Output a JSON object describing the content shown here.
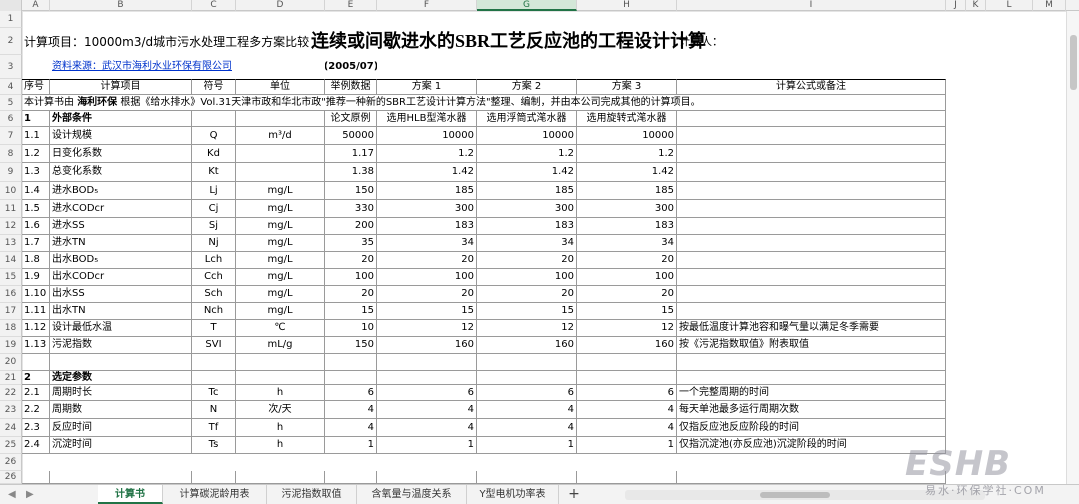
{
  "columns": [
    "A",
    "B",
    "C",
    "D",
    "E",
    "F",
    "G",
    "H",
    "I",
    "J",
    "K",
    "L",
    "M"
  ],
  "selected_column": "G",
  "title": "连续或间歇进水的SBR工艺反应池的工程设计计算",
  "project_label": "计算项目：",
  "project_name": "10000m3/d城市污水处理工程多方案比较",
  "calculator_label": "计算人：",
  "source_text": "资料来源：武汉市海利水业环保有限公司",
  "source_year": "(2005/07)",
  "headers": {
    "seq": "序号",
    "item": "计算项目",
    "symbol": "符号",
    "unit": "单位",
    "example": "举例数据",
    "plan1": "方案 1",
    "plan2": "方案 2",
    "plan3": "方案 3",
    "formula": "计算公式或备注"
  },
  "note_row": {
    "prefix": "本计算书由 ",
    "company": "海利环保",
    "suffix": " 根据《给水排水》Vol.31天津市政和华北市政\"推荐一种新的SBR工艺设计计算方法\"整理、编制，并由本公司完成其他的计算项目。"
  },
  "section1": {
    "num": "1",
    "name": "外部条件",
    "sub_example": "论文原例",
    "sub_plan1": "选用HLB型滗水器",
    "sub_plan2": "选用浮筒式滗水器",
    "sub_plan3": "选用旋转式滗水器"
  },
  "rows": [
    {
      "row": "7",
      "seq": "1.1",
      "item": "设计规模",
      "symbol": "Q",
      "unit": "m³/d",
      "ex": "50000",
      "p1": "10000",
      "p2": "10000",
      "p3": "10000",
      "note": ""
    },
    {
      "row": "8",
      "seq": "1.2",
      "item": "日变化系数",
      "symbol": "Kd",
      "unit": "",
      "ex": "1.17",
      "p1": "1.2",
      "p2": "1.2",
      "p3": "1.2",
      "note": ""
    },
    {
      "row": "9",
      "seq": "1.3",
      "item": "总变化系数",
      "symbol": "Kt",
      "unit": "",
      "ex": "1.38",
      "p1": "1.42",
      "p2": "1.42",
      "p3": "1.42",
      "note": ""
    },
    {
      "row": "10",
      "seq": "1.4",
      "item": "进水BOD₅",
      "symbol": "Lj",
      "unit": "mg/L",
      "ex": "150",
      "p1": "185",
      "p2": "185",
      "p3": "185",
      "note": ""
    },
    {
      "row": "11",
      "seq": "1.5",
      "item": "进水CODcr",
      "symbol": "Cj",
      "unit": "mg/L",
      "ex": "330",
      "p1": "300",
      "p2": "300",
      "p3": "300",
      "note": ""
    },
    {
      "row": "12",
      "seq": "1.6",
      "item": "进水SS",
      "symbol": "Sj",
      "unit": "mg/L",
      "ex": "200",
      "p1": "183",
      "p2": "183",
      "p3": "183",
      "note": ""
    },
    {
      "row": "13",
      "seq": "1.7",
      "item": "进水TN",
      "symbol": "Nj",
      "unit": "mg/L",
      "ex": "35",
      "p1": "34",
      "p2": "34",
      "p3": "34",
      "note": ""
    },
    {
      "row": "14",
      "seq": "1.8",
      "item": "出水BOD₅",
      "symbol": "Lch",
      "unit": "mg/L",
      "ex": "20",
      "p1": "20",
      "p2": "20",
      "p3": "20",
      "note": ""
    },
    {
      "row": "15",
      "seq": "1.9",
      "item": "出水CODcr",
      "symbol": "Cch",
      "unit": "mg/L",
      "ex": "100",
      "p1": "100",
      "p2": "100",
      "p3": "100",
      "note": ""
    },
    {
      "row": "16",
      "seq": "1.10",
      "item": "出水SS",
      "symbol": "Sch",
      "unit": "mg/L",
      "ex": "20",
      "p1": "20",
      "p2": "20",
      "p3": "20",
      "note": ""
    },
    {
      "row": "17",
      "seq": "1.11",
      "item": "出水TN",
      "symbol": "Nch",
      "unit": "mg/L",
      "ex": "15",
      "p1": "15",
      "p2": "15",
      "p3": "15",
      "note": ""
    },
    {
      "row": "18",
      "seq": "1.12",
      "item": "设计最低水温",
      "symbol": "T",
      "unit": "℃",
      "ex": "10",
      "p1": "12",
      "p2": "12",
      "p3": "12",
      "note": "按最低温度计算池容和曝气量以满足冬季需要"
    },
    {
      "row": "19",
      "seq": "1.13",
      "item": "污泥指数",
      "symbol": "SVI",
      "unit": "mL/g",
      "ex": "150",
      "p1": "160",
      "p2": "160",
      "p3": "160",
      "note": "按《污泥指数取值》附表取值"
    }
  ],
  "section2": {
    "num": "2",
    "name": "选定参数"
  },
  "rows2": [
    {
      "row": "22",
      "seq": "2.1",
      "item": "周期时长",
      "symbol": "Tc",
      "unit": "h",
      "ex": "6",
      "p1": "6",
      "p2": "6",
      "p3": "6",
      "note": "一个完整周期的时间"
    },
    {
      "row": "23",
      "seq": "2.2",
      "item": "周期数",
      "symbol": "N",
      "unit": "次/天",
      "ex": "4",
      "p1": "4",
      "p2": "4",
      "p3": "4",
      "note": "每天单池最多运行周期次数"
    },
    {
      "row": "24",
      "seq": "2.3",
      "item": "反应时间",
      "symbol": "Tf",
      "unit": "h",
      "ex": "4",
      "p1": "4",
      "p2": "4",
      "p3": "4",
      "note": "仅指反应池反应阶段的时间"
    },
    {
      "row": "25",
      "seq": "2.4",
      "item": "沉淀时间",
      "symbol": "Ts",
      "unit": "h",
      "ex": "1",
      "p1": "1",
      "p2": "1",
      "p3": "1",
      "note": "仅指沉淀池(亦反应池)沉淀阶段的时间"
    }
  ],
  "tabs": [
    "计算书",
    "计算碳泥龄用表",
    "污泥指数取值",
    "含氧量与温度关系",
    "Y型电机功率表"
  ],
  "add_tab": "+",
  "watermark": "ESHB",
  "watermark_sub": "易水·环保学社·COM"
}
